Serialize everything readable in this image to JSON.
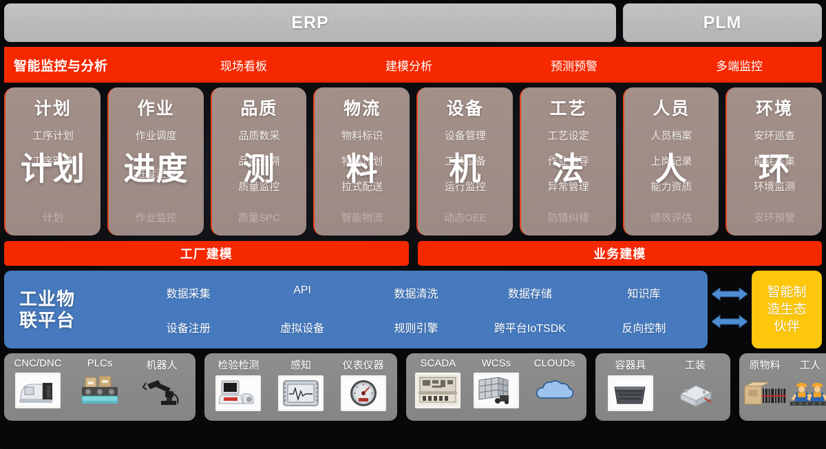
{
  "top_systems": [
    {
      "label": "ERP",
      "name": "erp"
    },
    {
      "label": "PLM",
      "name": "plm"
    }
  ],
  "monitoring": {
    "title": "智能监控与分析",
    "items": [
      {
        "label": "现场看板"
      },
      {
        "label": "建模分析"
      },
      {
        "label": "预测预警"
      },
      {
        "label": "多端监控"
      }
    ]
  },
  "domain_cards": [
    {
      "title": "计划",
      "watermark": "计划",
      "lines": [
        "工序计划",
        "工序跟踪"
      ],
      "footer": "计划"
    },
    {
      "title": "作业",
      "watermark": "进度",
      "lines": [
        "作业调度",
        "进度汇报"
      ],
      "footer": "作业监控"
    },
    {
      "title": "品质",
      "watermark": "测",
      "lines": [
        "品质数采",
        "品质追溯",
        "质量监控"
      ],
      "footer": "质量SPC"
    },
    {
      "title": "物流",
      "watermark": "料",
      "lines": [
        "物料标识",
        "物料计划",
        "拉式配送"
      ],
      "footer": "智能物流"
    },
    {
      "title": "设备",
      "watermark": "机",
      "lines": [
        "设备管理",
        "工装设备",
        "运行监控"
      ],
      "footer": "动态OEE"
    },
    {
      "title": "工艺",
      "watermark": "法",
      "lines": [
        "工艺设定",
        "作业指导",
        "异常管理"
      ],
      "footer": "防错纠错"
    },
    {
      "title": "人员",
      "watermark": "人",
      "lines": [
        "人员档案",
        "上岗记录",
        "能力资质"
      ],
      "footer": "绩效评估"
    },
    {
      "title": "环境",
      "watermark": "环",
      "lines": [
        "安环巡查",
        "能耗采集",
        "环境监测"
      ],
      "footer": "安环预警"
    }
  ],
  "modeling_bars": [
    {
      "label": "工厂建模"
    },
    {
      "label": "业务建模"
    }
  ],
  "iot_platform": {
    "label": "工业物\n联平台",
    "label_line1": "工业物",
    "label_line2": "联平台",
    "row1": [
      "数据采集",
      "API",
      "数据清洗",
      "数据存储",
      "知识库"
    ],
    "row2": [
      "设备注册",
      "虚拟设备",
      "规则引擎",
      "跨平台IoTSDK",
      "反向控制"
    ]
  },
  "ecosystem": {
    "line1": "智能制",
    "line2": "造生态",
    "line3": "伙伴"
  },
  "device_groups": [
    {
      "name": "automation",
      "items": [
        {
          "label": "CNC/DNC",
          "icon": "cnc-machine-icon"
        },
        {
          "label": "PLCs",
          "icon": "plc-rack-icon"
        },
        {
          "label": "机器人",
          "icon": "robot-arm-icon"
        }
      ]
    },
    {
      "name": "inspection",
      "items": [
        {
          "label": "检验检测",
          "icon": "inspection-station-icon"
        },
        {
          "label": "感知",
          "icon": "sensor-monitor-icon"
        },
        {
          "label": "仪表仪器",
          "icon": "gauge-icon"
        }
      ]
    },
    {
      "name": "systems",
      "items": [
        {
          "label": "SCADA",
          "icon": "scada-panel-icon"
        },
        {
          "label": "WCSs",
          "icon": "warehouse-control-icon"
        },
        {
          "label": "CLOUDs",
          "icon": "cloud-icon"
        }
      ]
    },
    {
      "name": "containers",
      "items": [
        {
          "label": "容器具",
          "icon": "crate-icon"
        },
        {
          "label": "工装",
          "icon": "fixture-icon"
        }
      ]
    },
    {
      "name": "materials",
      "items": [
        {
          "label": "原物料",
          "icon": "barcode-carton-icon"
        },
        {
          "label": "工人",
          "icon": "worker-icon"
        }
      ]
    }
  ],
  "colors": {
    "accent_red": "#f52800",
    "platform_blue": "#4679bd",
    "eco_yellow": "#fdc70b",
    "card_brown": "#a39089",
    "system_gray": "#bcbcbc",
    "device_gray": "#8a8a8a"
  }
}
